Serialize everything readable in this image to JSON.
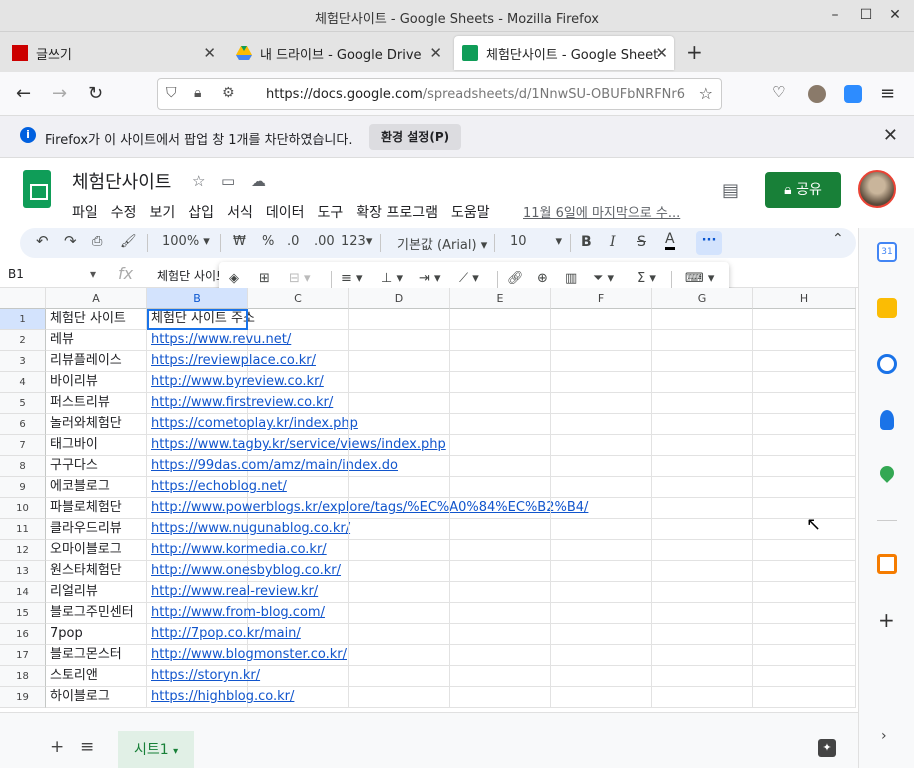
{
  "window": {
    "title": "체험단사이트 - Google Sheets - Mozilla Firefox"
  },
  "tabs": [
    {
      "label": "글쓰기"
    },
    {
      "label": "내 드라이브 - Google Drive"
    },
    {
      "label": "체험단사이트 - Google Sheets"
    }
  ],
  "nav": {
    "url_host": "https://docs.google.com",
    "url_path": "/spreadsheets/d/1NnwSU-OBUFbNRFNr6"
  },
  "notification": {
    "message": "Firefox가 이 사이트에서 팝업 창 1개를 차단하였습니다.",
    "pref_button": "환경 설정(P)"
  },
  "doc": {
    "title": "체험단사이트",
    "last_edit": "11월 6일에 마지막으로 수...",
    "share": "공유"
  },
  "menu": [
    "파일",
    "수정",
    "보기",
    "삽입",
    "서식",
    "데이터",
    "도구",
    "확장 프로그램",
    "도움말"
  ],
  "toolbar": {
    "zoom": "100%",
    "currency": "₩",
    "percent": "%",
    "dec_decrease": ".0",
    "dec_increase": ".00",
    "number_format": "123",
    "font": "기본값 (Arial)",
    "font_size": "10",
    "bold": "B",
    "italic": "I",
    "strike": "S",
    "text_color": "A",
    "more": "···"
  },
  "formula_bar": {
    "cell_ref": "B1",
    "fx": "fx",
    "value": "체험단 사이트 주소"
  },
  "grid": {
    "columns": [
      "A",
      "B",
      "C",
      "D",
      "E",
      "F",
      "G",
      "H"
    ],
    "rows": [
      {
        "n": "1",
        "a": "체험단 사이트",
        "b": "체험단 사이트 주소",
        "b_link": false
      },
      {
        "n": "2",
        "a": "레뷰",
        "b": "https://www.revu.net/",
        "b_link": true
      },
      {
        "n": "3",
        "a": "리뷰플레이스",
        "b": "https://reviewplace.co.kr/",
        "b_link": true
      },
      {
        "n": "4",
        "a": "바이리뷰",
        "b": "http://www.byreview.co.kr/",
        "b_link": true
      },
      {
        "n": "5",
        "a": "퍼스트리뷰",
        "b": "http://www.firstreview.co.kr/",
        "b_link": true
      },
      {
        "n": "6",
        "a": "놀러와체험단",
        "b": "https://cometoplay.kr/index.php",
        "b_link": true
      },
      {
        "n": "7",
        "a": "태그바이",
        "b": "https://www.tagby.kr/service/views/index.php",
        "b_link": true
      },
      {
        "n": "8",
        "a": "구구다스",
        "b": "https://99das.com/amz/main/index.do",
        "b_link": true
      },
      {
        "n": "9",
        "a": "에코블로그",
        "b": "https://echoblog.net/",
        "b_link": true
      },
      {
        "n": "10",
        "a": "파블로체험단",
        "b": "http://www.powerblogs.kr/explore/tags/%EC%A0%84%EC%B2%B4/",
        "b_link": true
      },
      {
        "n": "11",
        "a": "클라우드리뷰",
        "b": "https://www.nugunablog.co.kr/",
        "b_link": true
      },
      {
        "n": "12",
        "a": "오마이블로그",
        "b": "http://www.kormedia.co.kr/",
        "b_link": true
      },
      {
        "n": "13",
        "a": "원스타체험단",
        "b": "http://www.onesbyblog.co.kr/",
        "b_link": true
      },
      {
        "n": "14",
        "a": "리얼리뷰",
        "b": "http://www.real-review.kr/",
        "b_link": true
      },
      {
        "n": "15",
        "a": "블로그주민센터",
        "b": "http://www.from-blog.com/",
        "b_link": true
      },
      {
        "n": "16",
        "a": "7pop",
        "b": "http://7pop.co.kr/main/",
        "b_link": true
      },
      {
        "n": "17",
        "a": "블로그몬스터",
        "b": "http://www.blogmonster.co.kr/",
        "b_link": true
      },
      {
        "n": "18",
        "a": "스토리앤",
        "b": "https://storyn.kr/",
        "b_link": true
      },
      {
        "n": "19",
        "a": "하이블로그",
        "b": "https://highblog.co.kr/",
        "b_link": true
      }
    ]
  },
  "sheetbar": {
    "add": "+",
    "list": "≡",
    "sheet_name": "시트1"
  },
  "colors": {
    "sheets_green": "#0f9d58",
    "share_green": "#188038",
    "link_blue": "#1155cc",
    "selection_blue": "#1a73e8"
  }
}
